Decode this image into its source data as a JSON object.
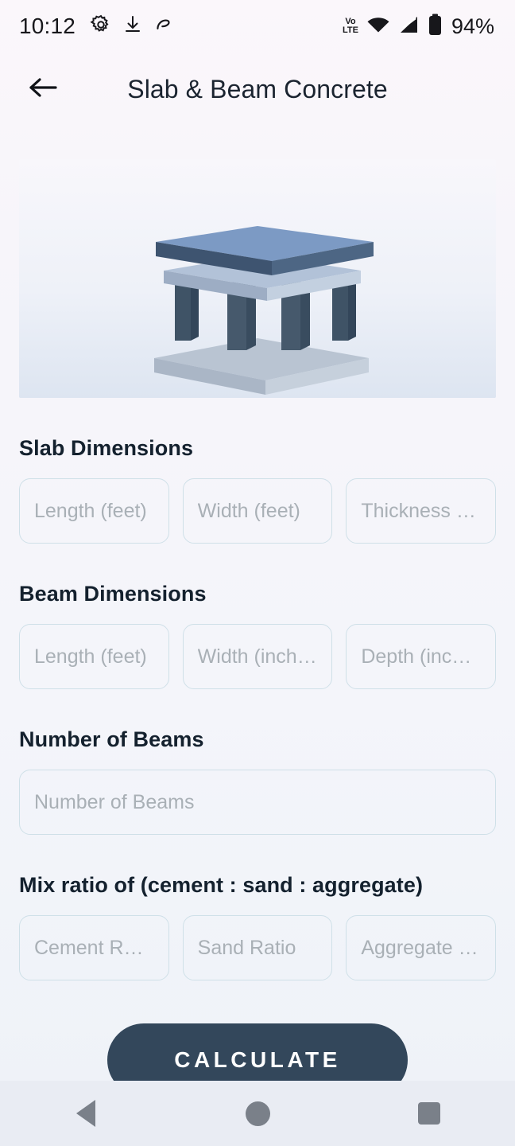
{
  "status_bar": {
    "time": "10:12",
    "icons": [
      "gear-icon",
      "download-icon",
      "data-saver-icon"
    ],
    "network_label_top": "Vo",
    "network_label_bottom": "LTE",
    "right_icons": [
      "volte-icon",
      "wifi-icon",
      "signal-icon",
      "battery-icon"
    ],
    "battery_percent": "94%"
  },
  "app_bar": {
    "back_icon": "arrow-left-icon",
    "title": "Slab & Beam Concrete"
  },
  "hero": {
    "illustration": "slab-and-beam-3d-illustration",
    "alt": "3D illustration of a concrete slab supported by beams and columns"
  },
  "form": {
    "slab": {
      "label": "Slab Dimensions",
      "fields": [
        {
          "name": "slab-length",
          "placeholder": "Length (feet)",
          "value": ""
        },
        {
          "name": "slab-width",
          "placeholder": "Width (feet)",
          "value": ""
        },
        {
          "name": "slab-thickness",
          "placeholder": "Thickness (i…",
          "value": ""
        }
      ]
    },
    "beam": {
      "label": "Beam Dimensions",
      "fields": [
        {
          "name": "beam-length",
          "placeholder": "Length (feet)",
          "value": ""
        },
        {
          "name": "beam-width",
          "placeholder": "Width (inche…",
          "value": ""
        },
        {
          "name": "beam-depth",
          "placeholder": "Depth (inche…",
          "value": ""
        }
      ]
    },
    "beams_count": {
      "label": "Number of Beams",
      "field": {
        "name": "number-of-beams",
        "placeholder": "Number of Beams",
        "value": ""
      }
    },
    "mix_ratio": {
      "label": "Mix ratio of (cement : sand : aggregate)",
      "fields": [
        {
          "name": "cement-ratio",
          "placeholder": "Cement Ratio",
          "value": ""
        },
        {
          "name": "sand-ratio",
          "placeholder": "Sand Ratio",
          "value": ""
        },
        {
          "name": "aggregate-ratio",
          "placeholder": "Aggregate R…",
          "value": ""
        }
      ]
    },
    "submit_label": "CALCULATE"
  },
  "nav_bar": {
    "back": "back-triangle-icon",
    "home": "home-circle-icon",
    "recents": "recents-square-icon"
  },
  "colors": {
    "background_top": "#fbf7fb",
    "background_bottom": "#eef2f8",
    "field_border": "#cfe0e8",
    "placeholder": "#a9b0b6",
    "heading": "#14212e",
    "cta_bg": "#33475b",
    "navbar_bg": "#e9ecf3"
  }
}
